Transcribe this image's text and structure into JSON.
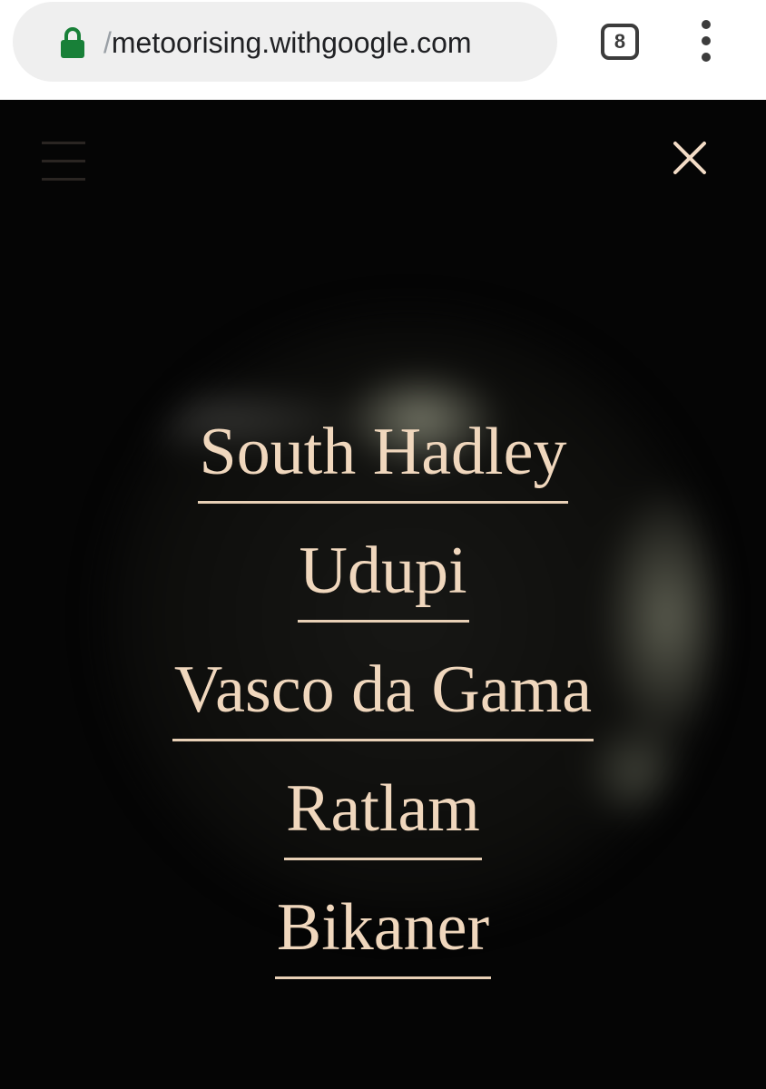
{
  "browser": {
    "url_prefix": "/",
    "url": "metoorising.withgoogle.com",
    "tab_count": "8",
    "lock_icon": "lock-icon",
    "menu_icon": "more-vert-icon",
    "secure_color": "#188038"
  },
  "header": {
    "menu_icon": "hamburger-icon",
    "close_icon": "close-icon"
  },
  "nav": {
    "items": [
      {
        "label": "South Hadley"
      },
      {
        "label": "Udupi"
      },
      {
        "label": "Vasco da Gama"
      },
      {
        "label": "Ratlam"
      },
      {
        "label": "Bikaner"
      }
    ]
  },
  "colors": {
    "background": "#050505",
    "link": "#f0d7bd"
  }
}
